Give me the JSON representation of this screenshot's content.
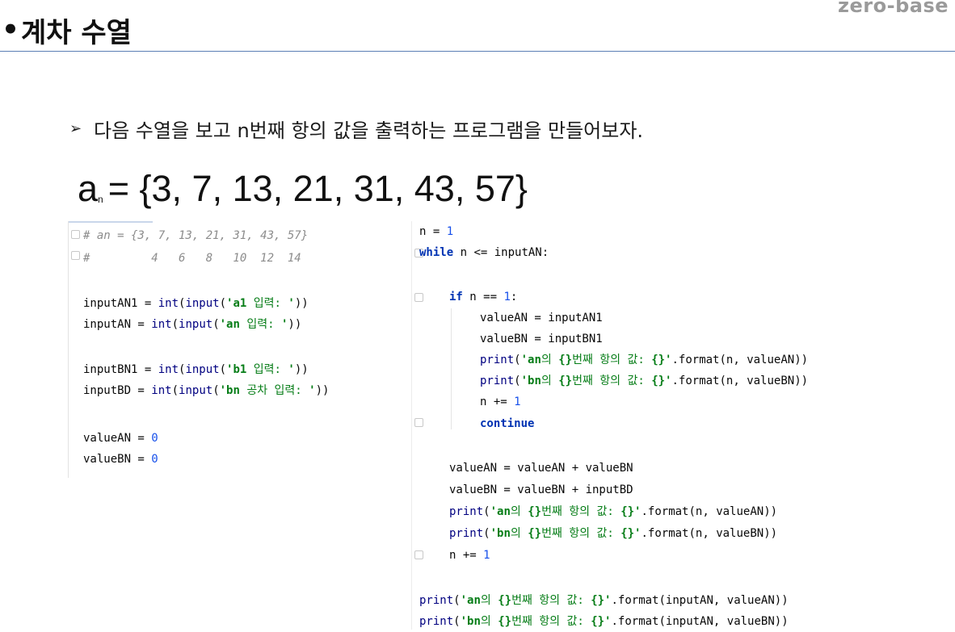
{
  "header": {
    "brand": "zero-base",
    "bullet": "•",
    "title": "계차 수열"
  },
  "task": {
    "arrow": "➢",
    "text": "다음 수열을 보고 n번째 항의 값을 출력하는 프로그램을 만들어보자."
  },
  "formula": {
    "base": "a",
    "subscript": "n",
    "rest": "= {3, 7, 13, 21, 31, 43, 57}"
  },
  "left_code": [
    [
      "# an = {3, 7, 13, 21, 31, 43, 57}"
    ],
    [
      "#         4   6   8   10  12  14"
    ],
    [
      "inputAN1 = ",
      "int",
      "(",
      "input",
      "(",
      "'a1 ",
      "입력: ",
      "'",
      "))"
    ],
    [
      "inputAN = ",
      "int",
      "(",
      "input",
      "(",
      "'an ",
      "입력: ",
      "'",
      "))"
    ],
    [
      "inputBN1 = ",
      "int",
      "(",
      "input",
      "(",
      "'b1 ",
      "입력: ",
      "'",
      "))"
    ],
    [
      "inputBD = ",
      "int",
      "(",
      "input",
      "(",
      "'bn ",
      "공차 입력: ",
      "'",
      "))"
    ],
    [
      "valueAN = ",
      "0"
    ],
    [
      "valueBN = ",
      "0"
    ]
  ],
  "right_code": [
    [
      "n = ",
      "1"
    ],
    [
      "while",
      " n <= inputAN:"
    ],
    [
      "if",
      " n == ",
      "1",
      ":"
    ],
    [
      "valueAN = inputAN1"
    ],
    [
      "valueBN = inputBN1"
    ],
    [
      "print",
      "(",
      "'an",
      "의 ",
      "{}",
      "번째 항의 값: ",
      "{}",
      "'",
      ".format(n, valueAN))"
    ],
    [
      "print",
      "(",
      "'bn",
      "의 ",
      "{}",
      "번째 항의 값: ",
      "{}",
      "'",
      ".format(n, valueBN))"
    ],
    [
      "n += ",
      "1"
    ],
    [
      "continue"
    ],
    [
      "valueAN = valueAN + valueBN"
    ],
    [
      "valueBN = valueBN + inputBD"
    ],
    [
      "print",
      "(",
      "'an",
      "의 ",
      "{}",
      "번째 항의 값: ",
      "{}",
      "'",
      ".format(n, valueAN))"
    ],
    [
      "print",
      "(",
      "'bn",
      "의 ",
      "{}",
      "번째 항의 값: ",
      "{}",
      "'",
      ".format(n, valueBN))"
    ],
    [
      "n += ",
      "1"
    ],
    [
      "print",
      "(",
      "'an",
      "의 ",
      "{}",
      "번째 항의 값: ",
      "{}",
      "'",
      ".format(inputAN, valueAN))"
    ],
    [
      "print",
      "(",
      "'bn",
      "의 ",
      "{}",
      "번째 항의 값: ",
      "{}",
      "'",
      ".format(inputAN, valueBN))"
    ]
  ]
}
